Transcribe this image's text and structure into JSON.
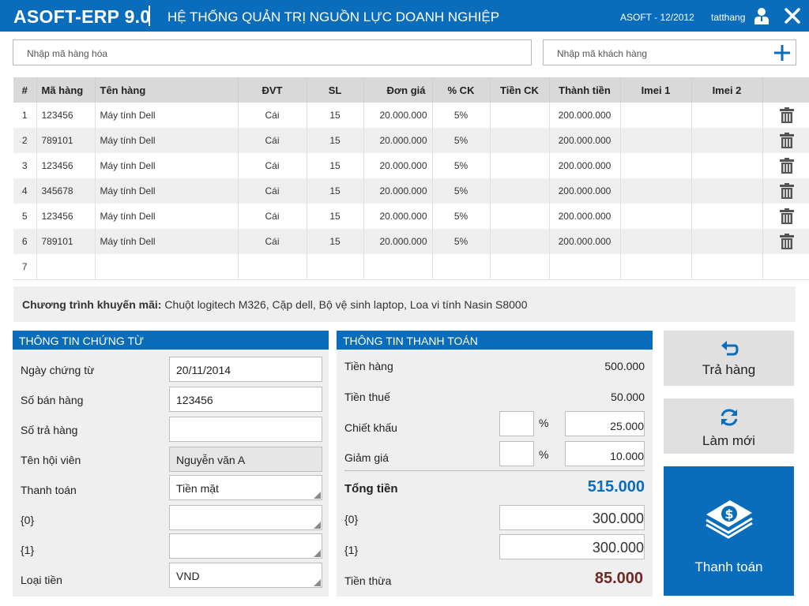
{
  "header": {
    "brand": "ASOFT-ERP 9.0",
    "system_title": "HỆ THỐNG QUẢN TRỊ NGUỒN LỰC DOANH NGHIỆP",
    "period": "ASOFT - 12/2012",
    "username": "tatthang",
    "user_icon": "user-icon",
    "close_icon": "close-icon"
  },
  "search": {
    "product_placeholder": "Nhập mã hàng hóa",
    "customer_placeholder": "Nhập mã khách hàng",
    "add_icon": "plus-icon"
  },
  "table": {
    "columns": [
      "#",
      "Mã hàng",
      "Tên hàng",
      "ĐVT",
      "SL",
      "Đơn giá",
      "% CK",
      "Tiền CK",
      "Thành tiền",
      "Imei 1",
      "Imei 2",
      ""
    ],
    "rows": [
      {
        "no": "1",
        "code": "123456",
        "name": "Máy tính Dell",
        "unit": "Cái",
        "qty": "15",
        "price": "20.000.000",
        "disc_pct": "5%",
        "disc_amt": "",
        "total": "200.000.000",
        "imei1": "",
        "imei2": ""
      },
      {
        "no": "2",
        "code": "789101",
        "name": "Máy tính Dell",
        "unit": "Cái",
        "qty": "15",
        "price": "20.000.000",
        "disc_pct": "5%",
        "disc_amt": "",
        "total": "200.000.000",
        "imei1": "",
        "imei2": ""
      },
      {
        "no": "3",
        "code": "123456",
        "name": "Máy tính Dell",
        "unit": "Cái",
        "qty": "15",
        "price": "20.000.000",
        "disc_pct": "5%",
        "disc_amt": "",
        "total": "200.000.000",
        "imei1": "",
        "imei2": ""
      },
      {
        "no": "4",
        "code": "345678",
        "name": "Máy tính Dell",
        "unit": "Cái",
        "qty": "15",
        "price": "20.000.000",
        "disc_pct": "5%",
        "disc_amt": "",
        "total": "200.000.000",
        "imei1": "",
        "imei2": ""
      },
      {
        "no": "5",
        "code": "123456",
        "name": "Máy tính Dell",
        "unit": "Cái",
        "qty": "15",
        "price": "20.000.000",
        "disc_pct": "5%",
        "disc_amt": "",
        "total": "200.000.000",
        "imei1": "",
        "imei2": ""
      },
      {
        "no": "6",
        "code": "789101",
        "name": "Máy tính Dell",
        "unit": "Cái",
        "qty": "15",
        "price": "20.000.000",
        "disc_pct": "5%",
        "disc_amt": "",
        "total": "200.000.000",
        "imei1": "",
        "imei2": ""
      }
    ],
    "empty_row_no": "7",
    "delete_icon": "trash-icon"
  },
  "promo": {
    "label": "Chương trình khuyến mãi:",
    "text": "Chuột logitech M326, Cặp dell, Bộ vệ sinh laptop, Loa vi tính Nasin S8000"
  },
  "voucher": {
    "title": "THÔNG TIN CHỨNG TỪ",
    "fields": [
      {
        "label": "Ngày chứng từ",
        "value": "20/11/2014"
      },
      {
        "label": "Số bán hàng",
        "value": "123456"
      },
      {
        "label": "Số trả hàng",
        "value": ""
      },
      {
        "label": "Tên hội viên",
        "value": "Nguyễn văn A"
      },
      {
        "label": "Thanh toán",
        "value": "Tiền mặt"
      },
      {
        "label": "{0}",
        "value": ""
      },
      {
        "label": "{1}",
        "value": ""
      },
      {
        "label": "Loại tiền",
        "value": "VND"
      }
    ]
  },
  "payment": {
    "title": "THÔNG TIN THANH TOÁN",
    "goods_label": "Tiền hàng",
    "goods_value": "500.000",
    "tax_label": "Tiền thuế",
    "tax_value": "50.000",
    "discount_label": "Chiết khấu",
    "discount_pct": "",
    "discount_value": "25.000",
    "reduce_label": "Giảm giá",
    "reduce_pct": "",
    "reduce_value": "10.000",
    "percent_sign": "%",
    "total_label": "Tổng tiền",
    "total_value": "515.000",
    "pay0_label": "{0}",
    "pay0_value": "300.000",
    "pay1_label": "{1}",
    "pay1_value": "300.000",
    "change_label": "Tiền thừa",
    "change_value": "85.000"
  },
  "actions": {
    "return_label": "Trả hàng",
    "return_icon": "undo-icon",
    "refresh_label": "Làm mới",
    "refresh_icon": "refresh-icon",
    "pay_label": "Thanh toán",
    "pay_icon": "money-icon"
  },
  "colors": {
    "primary": "#0a6dbb",
    "total": "#0a6dbb",
    "change": "#6b2a26"
  }
}
